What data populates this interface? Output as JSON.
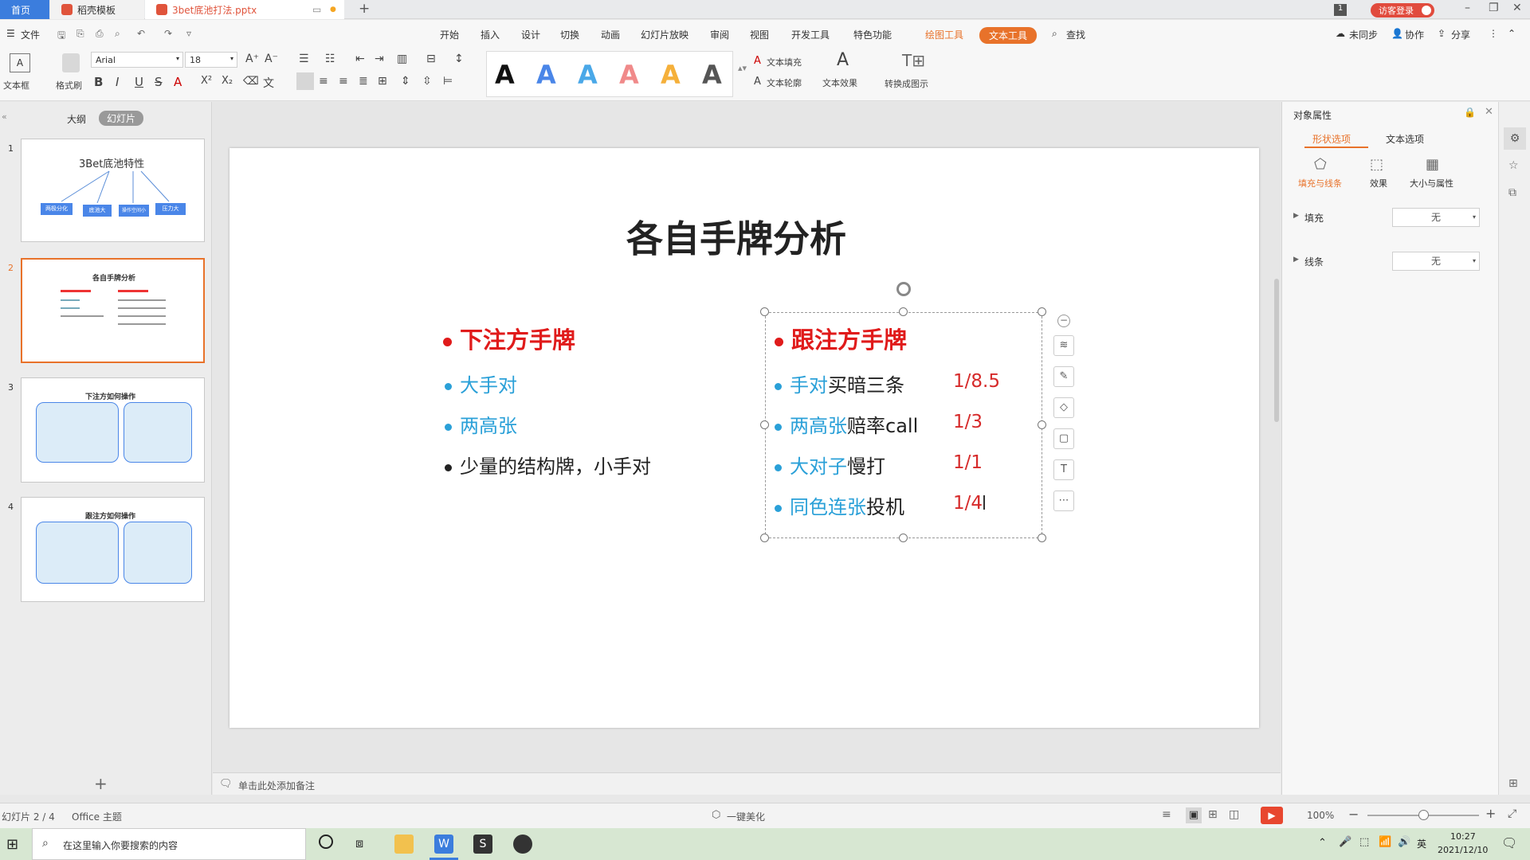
{
  "titlebar": {
    "tabs": [
      {
        "label": "首页"
      },
      {
        "label": "稻壳模板"
      },
      {
        "label": "3bet底池打法.pptx"
      }
    ],
    "new_tab": "+",
    "badge": "1",
    "login": "访客登录"
  },
  "menubar": {
    "file": "文件",
    "items": [
      "开始",
      "插入",
      "设计",
      "切换",
      "动画",
      "幻灯片放映",
      "审阅",
      "视图",
      "开发工具",
      "特色功能"
    ],
    "drawing_tools": "绘图工具",
    "text_tools": "文本工具",
    "search": "查找",
    "right": [
      "未同步",
      "协作",
      "分享"
    ]
  },
  "ribbon": {
    "textbox_label": "文本框",
    "format_brush": "格式刷",
    "font_name": "Arial",
    "font_size": "18",
    "text_fill": "文本填充",
    "text_outline": "文本轮廓",
    "text_effect": "文本效果",
    "convert": "转换成图示",
    "style_letters": [
      "A",
      "A",
      "A",
      "A",
      "A",
      "A"
    ],
    "style_colors": [
      "#111111",
      "#4a86e8",
      "#4aa8e8",
      "#f08a8a",
      "#f5b03a",
      "#555555"
    ]
  },
  "leftpane": {
    "tab_outline": "大纲",
    "tab_slides": "幻灯片",
    "thumbs": [
      {
        "num": "1",
        "title": "3Bet底池特性",
        "boxes": [
          "两极分化",
          "底池大",
          "操作空间小",
          "压力大"
        ]
      },
      {
        "num": "2",
        "title": "各自手牌分析"
      },
      {
        "num": "3",
        "title": "下注方如何操作"
      },
      {
        "num": "4",
        "title": "跟注方如何操作"
      }
    ],
    "add": "+"
  },
  "slide": {
    "title": "各自手牌分析",
    "left_heading": "下注方手牌",
    "left_items": [
      {
        "text": "大手对",
        "color": "#2aa0d8"
      },
      {
        "text": "两高张",
        "color": "#2aa0d8"
      },
      {
        "text": "少量的结构牌，小手对",
        "color": "#222222"
      }
    ],
    "right_heading": "跟注方手牌",
    "right_items": [
      {
        "blue": "手对",
        "black": "买暗三条",
        "ratio": "1/8.5"
      },
      {
        "blue": "两高张",
        "black": "赔率call",
        "ratio": "1/3"
      },
      {
        "blue": "大对子",
        "black": "慢打",
        "ratio": "1/1"
      },
      {
        "blue": "同色连张",
        "black": "投机",
        "ratio": "1/4"
      }
    ]
  },
  "notes_placeholder": "单击此处添加备注",
  "rightpane": {
    "title": "对象属性",
    "tab_shape": "形状选项",
    "tab_text": "文本选项",
    "sub_fill_line": "填充与线条",
    "sub_effect": "效果",
    "sub_size": "大小与属性",
    "fill_label": "填充",
    "fill_value": "无",
    "line_label": "线条",
    "line_value": "无"
  },
  "status": {
    "slide_info": "幻灯片 2 / 4",
    "theme": "Office 主题",
    "beautify": "一键美化",
    "zoom": "100%"
  },
  "taskbar": {
    "search_placeholder": "在这里输入你要搜索的内容",
    "ime": "英",
    "time": "10:27",
    "date": "2021/12/10"
  }
}
